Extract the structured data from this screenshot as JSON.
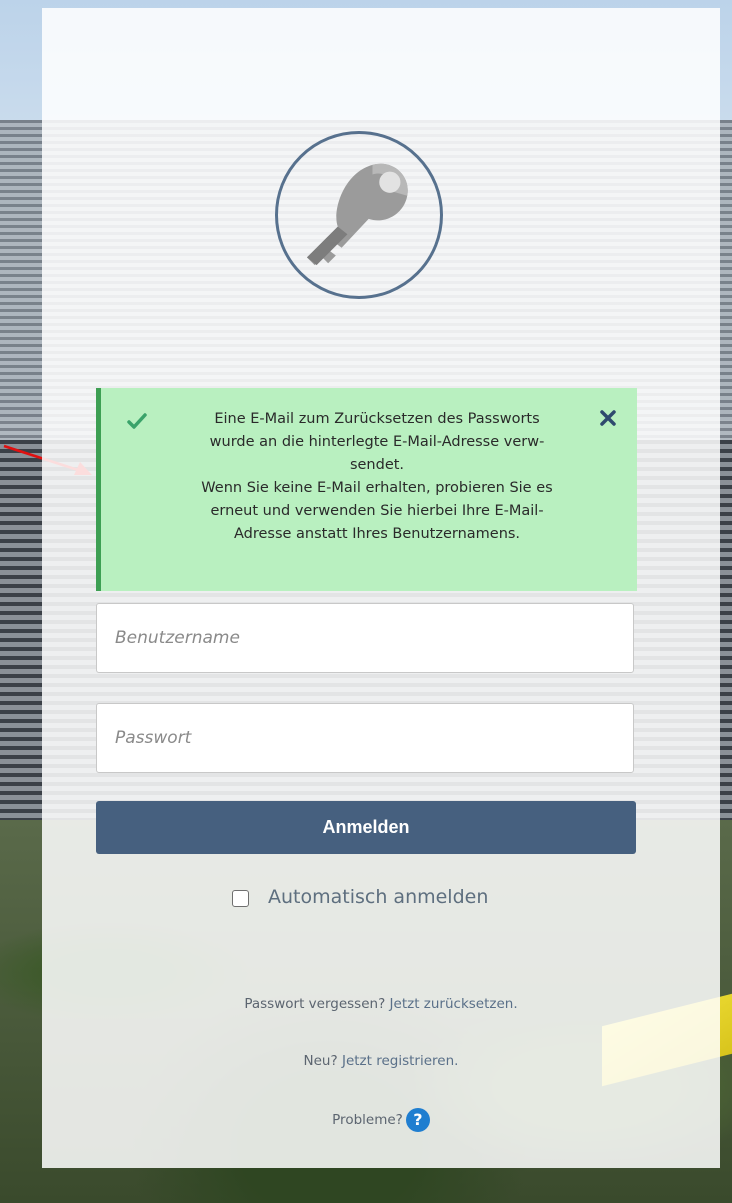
{
  "alert": {
    "lines": [
      "Eine E-Mail zum Zurücksetzen des Passworts",
      "wurde an die hinterlegte E-Mail-Adresse verw-",
      "sendet.",
      "Wenn Sie keine E-Mail erhalten, probieren Sie es",
      "erneut und verwenden Sie hierbei Ihre E-Mail-",
      "Adresse anstatt Ihres Benutzernamens."
    ],
    "status_color": "#3d9f53",
    "background": "#b9f0c0",
    "icons": {
      "success": "check-icon",
      "dismiss": "close-icon"
    }
  },
  "form": {
    "username_placeholder": "Benutzername",
    "username_value": "",
    "password_placeholder": "Passwort",
    "password_value": "",
    "login_label": "Anmelden",
    "remember_label": "Automatisch anmelden",
    "remember_checked": false
  },
  "links": {
    "forgot_prefix": "Passwort vergessen?",
    "forgot_link": "Jetzt zurücksetzen.",
    "new_prefix": "Neu?",
    "register_link": "Jetzt registrieren.",
    "problems_label": "Probleme?",
    "help_glyph": "?"
  },
  "colors": {
    "primary": "#46607f",
    "key_ring": "#57718e",
    "annotation_arrow": "#e01010"
  }
}
